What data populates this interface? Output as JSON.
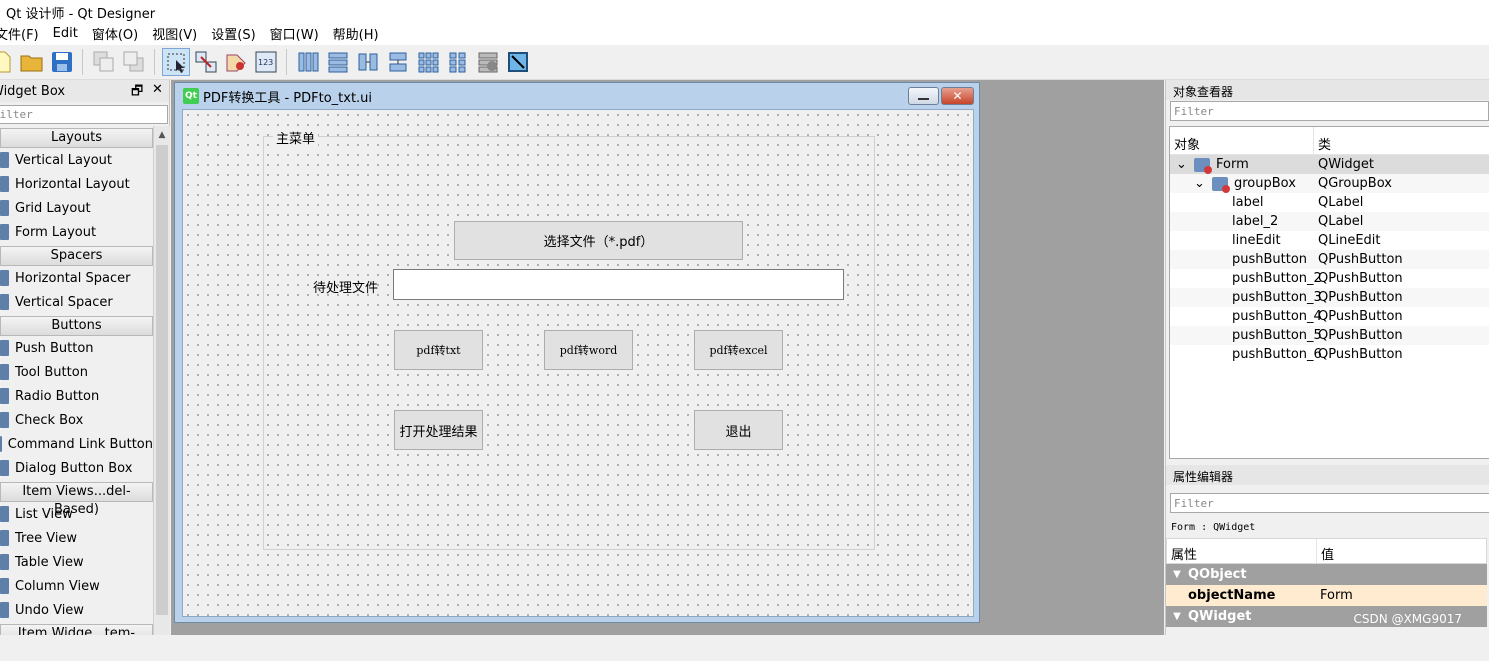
{
  "window": {
    "title": "Qt 设计师 - Qt Designer"
  },
  "menu": [
    "文件(F)",
    "Edit",
    "窗体(O)",
    "视图(V)",
    "设置(S)",
    "窗口(W)",
    "帮助(H)"
  ],
  "toolbar": {
    "icons": [
      "new-file-icon",
      "open-folder-icon",
      "save-icon",
      "send-to-back-icon",
      "bring-to-front-icon",
      "edit-widgets-icon",
      "edit-signals-slots-icon",
      "edit-buddies-icon",
      "edit-tab-order-icon",
      "lay-out-horizontally-icon",
      "lay-out-vertically-icon",
      "lay-out-horizontal-splitter-icon",
      "lay-out-vertical-splitter-icon",
      "lay-out-grid-icon",
      "lay-out-form-icon",
      "break-layout-icon",
      "adjust-size-icon"
    ]
  },
  "widget_box": {
    "title": "Widget Box",
    "float_btn": "🗗",
    "close_btn": "✕",
    "filter_placeholder": "Filter",
    "sections": [
      {
        "label": "Layouts",
        "items": [
          "Vertical Layout",
          "Horizontal Layout",
          "Grid Layout",
          "Form Layout"
        ]
      },
      {
        "label": "Spacers",
        "items": [
          "Horizontal Spacer",
          "Vertical Spacer"
        ]
      },
      {
        "label": "Buttons",
        "items": [
          "Push Button",
          "Tool Button",
          "Radio Button",
          "Check Box",
          "Command Link Button",
          "Dialog Button Box"
        ]
      },
      {
        "label": "Item Views...del-Based)",
        "items": [
          "List View",
          "Tree View",
          "Table View",
          "Column View",
          "Undo View"
        ]
      },
      {
        "label": "Item Widge...tem-Based)",
        "items": []
      }
    ]
  },
  "form": {
    "title": "PDF转换工具 - PDFto_txt.ui",
    "qt_logo": "Qt",
    "group_title": "主菜单",
    "select_file": "选择文件（*.pdf）",
    "pending_label": "待处理文件",
    "line_edit_value": "",
    "btn_txt": "pdf转txt",
    "btn_word": "pdf转word",
    "btn_excel": "pdf转excel",
    "btn_open": "打开处理结果",
    "btn_exit": "退出"
  },
  "object_inspector": {
    "title": "对象查看器",
    "filter_placeholder": "Filter",
    "col_object": "对象",
    "col_class": "类",
    "rows": [
      {
        "name": "Form",
        "cls": "QWidget"
      },
      {
        "name": "groupBox",
        "cls": "QGroupBox"
      },
      {
        "name": "label",
        "cls": "QLabel"
      },
      {
        "name": "label_2",
        "cls": "QLabel"
      },
      {
        "name": "lineEdit",
        "cls": "QLineEdit"
      },
      {
        "name": "pushButton",
        "cls": "QPushButton"
      },
      {
        "name": "pushButton_2",
        "cls": "QPushButton"
      },
      {
        "name": "pushButton_3",
        "cls": "QPushButton"
      },
      {
        "name": "pushButton_4",
        "cls": "QPushButton"
      },
      {
        "name": "pushButton_5",
        "cls": "QPushButton"
      },
      {
        "name": "pushButton_6",
        "cls": "QPushButton"
      }
    ]
  },
  "property_editor": {
    "title": "属性编辑器",
    "filter_placeholder": "Filter",
    "class_line": "Form : QWidget",
    "col_prop": "属性",
    "col_value": "值",
    "section_qobject": "QObject",
    "objectName_label": "objectName",
    "objectName_value": "Form",
    "section_qwidget": "QWidget"
  },
  "watermark": "CSDN @XMG9017"
}
